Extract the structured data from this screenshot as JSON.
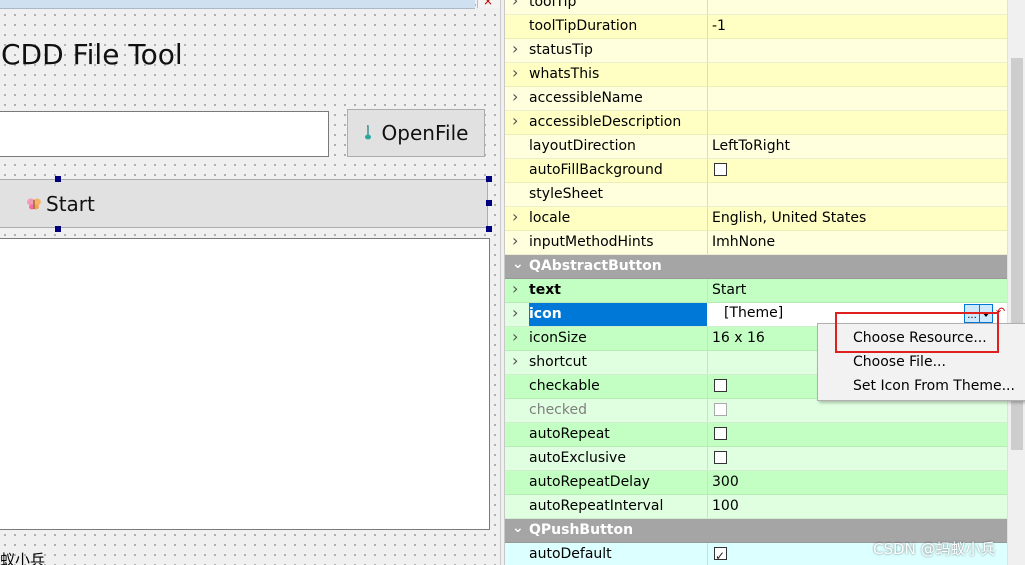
{
  "form": {
    "app_title": "CDD File Tool",
    "file_path_value": "",
    "openfile_label": "OpenFile",
    "start_label": "Start",
    "status_text": "蚁小兵"
  },
  "property_editor": {
    "rows": [
      {
        "name": "toolTip",
        "value": "",
        "kind": "expand",
        "color": "y-a"
      },
      {
        "name": "toolTipDuration",
        "value": "-1",
        "kind": "plain",
        "color": "y-b"
      },
      {
        "name": "statusTip",
        "value": "",
        "kind": "expand",
        "color": "y-a"
      },
      {
        "name": "whatsThis",
        "value": "",
        "kind": "expand",
        "color": "y-b"
      },
      {
        "name": "accessibleName",
        "value": "",
        "kind": "expand",
        "color": "y-a"
      },
      {
        "name": "accessibleDescription",
        "value": "",
        "kind": "expand",
        "color": "y-b"
      },
      {
        "name": "layoutDirection",
        "value": "LeftToRight",
        "kind": "plain",
        "color": "y-a"
      },
      {
        "name": "autoFillBackground",
        "value": "",
        "kind": "checkbox",
        "checked": false,
        "color": "y-b"
      },
      {
        "name": "styleSheet",
        "value": "",
        "kind": "plain",
        "color": "y-a"
      },
      {
        "name": "locale",
        "value": "English, United States",
        "kind": "expand",
        "color": "y-b"
      },
      {
        "name": "inputMethodHints",
        "value": "ImhNone",
        "kind": "expand",
        "color": "y-a"
      },
      {
        "name": "QAbstractButton",
        "value": "",
        "kind": "section",
        "color": "section"
      },
      {
        "name": "text",
        "value": "Start",
        "kind": "expand-bold",
        "color": "g-a"
      },
      {
        "name": "icon",
        "value": "",
        "kind": "icon-editor",
        "color": "g-b"
      },
      {
        "name": "iconSize",
        "value": "16 x 16",
        "kind": "expand",
        "color": "g-a"
      },
      {
        "name": "shortcut",
        "value": "",
        "kind": "expand",
        "color": "g-b"
      },
      {
        "name": "checkable",
        "value": "",
        "kind": "checkbox",
        "checked": false,
        "color": "g-a"
      },
      {
        "name": "checked",
        "value": "",
        "kind": "checkbox-disabled",
        "checked": false,
        "color": "g-b"
      },
      {
        "name": "autoRepeat",
        "value": "",
        "kind": "checkbox",
        "checked": false,
        "color": "g-a"
      },
      {
        "name": "autoExclusive",
        "value": "",
        "kind": "checkbox",
        "checked": false,
        "color": "g-b"
      },
      {
        "name": "autoRepeatDelay",
        "value": "300",
        "kind": "plain",
        "color": "g-a"
      },
      {
        "name": "autoRepeatInterval",
        "value": "100",
        "kind": "plain",
        "color": "g-b"
      },
      {
        "name": "QPushButton",
        "value": "",
        "kind": "section",
        "color": "section"
      },
      {
        "name": "autoDefault",
        "value": "",
        "kind": "checkbox",
        "checked": true,
        "color": "c-a"
      }
    ],
    "icon_editor": {
      "text": "[Theme]",
      "browse_label": "...",
      "reset_glyph": "↶"
    }
  },
  "icon_menu": {
    "items": [
      "Choose Resource...",
      "Choose File...",
      "Set Icon From Theme..."
    ]
  },
  "watermark": "CSDN @蚂蚁小兵",
  "colors": {
    "selection": "#0078d7",
    "highlight_box": "#e0201f",
    "section_header": "#a5a5a5"
  }
}
